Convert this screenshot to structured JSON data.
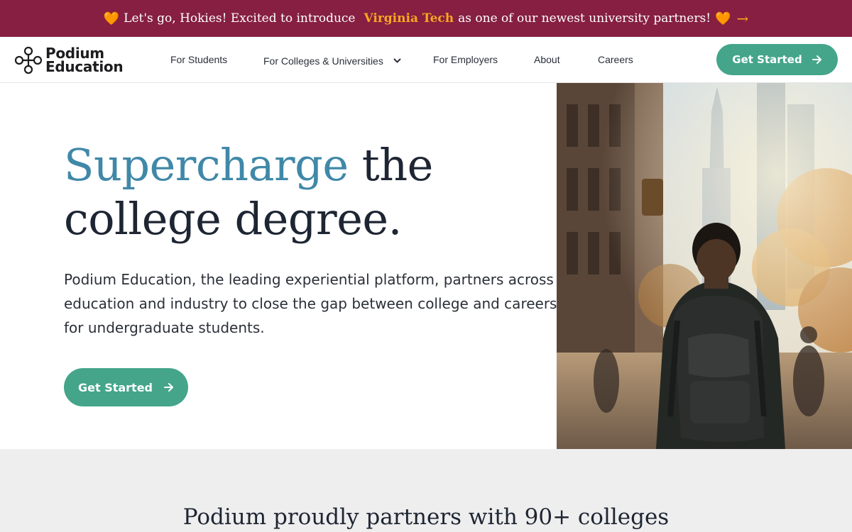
{
  "announcement": {
    "heart_left": "🧡",
    "text_before": "Let's go, Hokies! Excited to introduce",
    "highlight": "Virginia Tech",
    "text_after": "as one of our newest university partners!",
    "heart_right": "🧡",
    "arrow": "→"
  },
  "header": {
    "logo_line1": "Podium",
    "logo_line2": "Education",
    "nav": [
      {
        "label": "For Students"
      },
      {
        "label": "For Colleges & Universities"
      },
      {
        "label": "For Employers"
      },
      {
        "label": "About"
      },
      {
        "label": "Careers"
      }
    ],
    "cta_label": "Get Started"
  },
  "hero": {
    "headline_accent": "Supercharge",
    "headline_rest_line1": "the",
    "headline_line2": "college degree.",
    "subtext": "Podium Education, the leading experiential platform, partners across education and industry to close the gap between college and careers for undergraduate students.",
    "cta_label": "Get Started"
  },
  "partners": {
    "title": "Podium proudly partners with 90+ colleges"
  },
  "colors": {
    "announcement_bg": "#861f41",
    "announcement_highlight": "#f5a623",
    "brand_green": "#44a58a",
    "headline_accent": "#4088a8",
    "partners_bg": "#eeeeee"
  }
}
